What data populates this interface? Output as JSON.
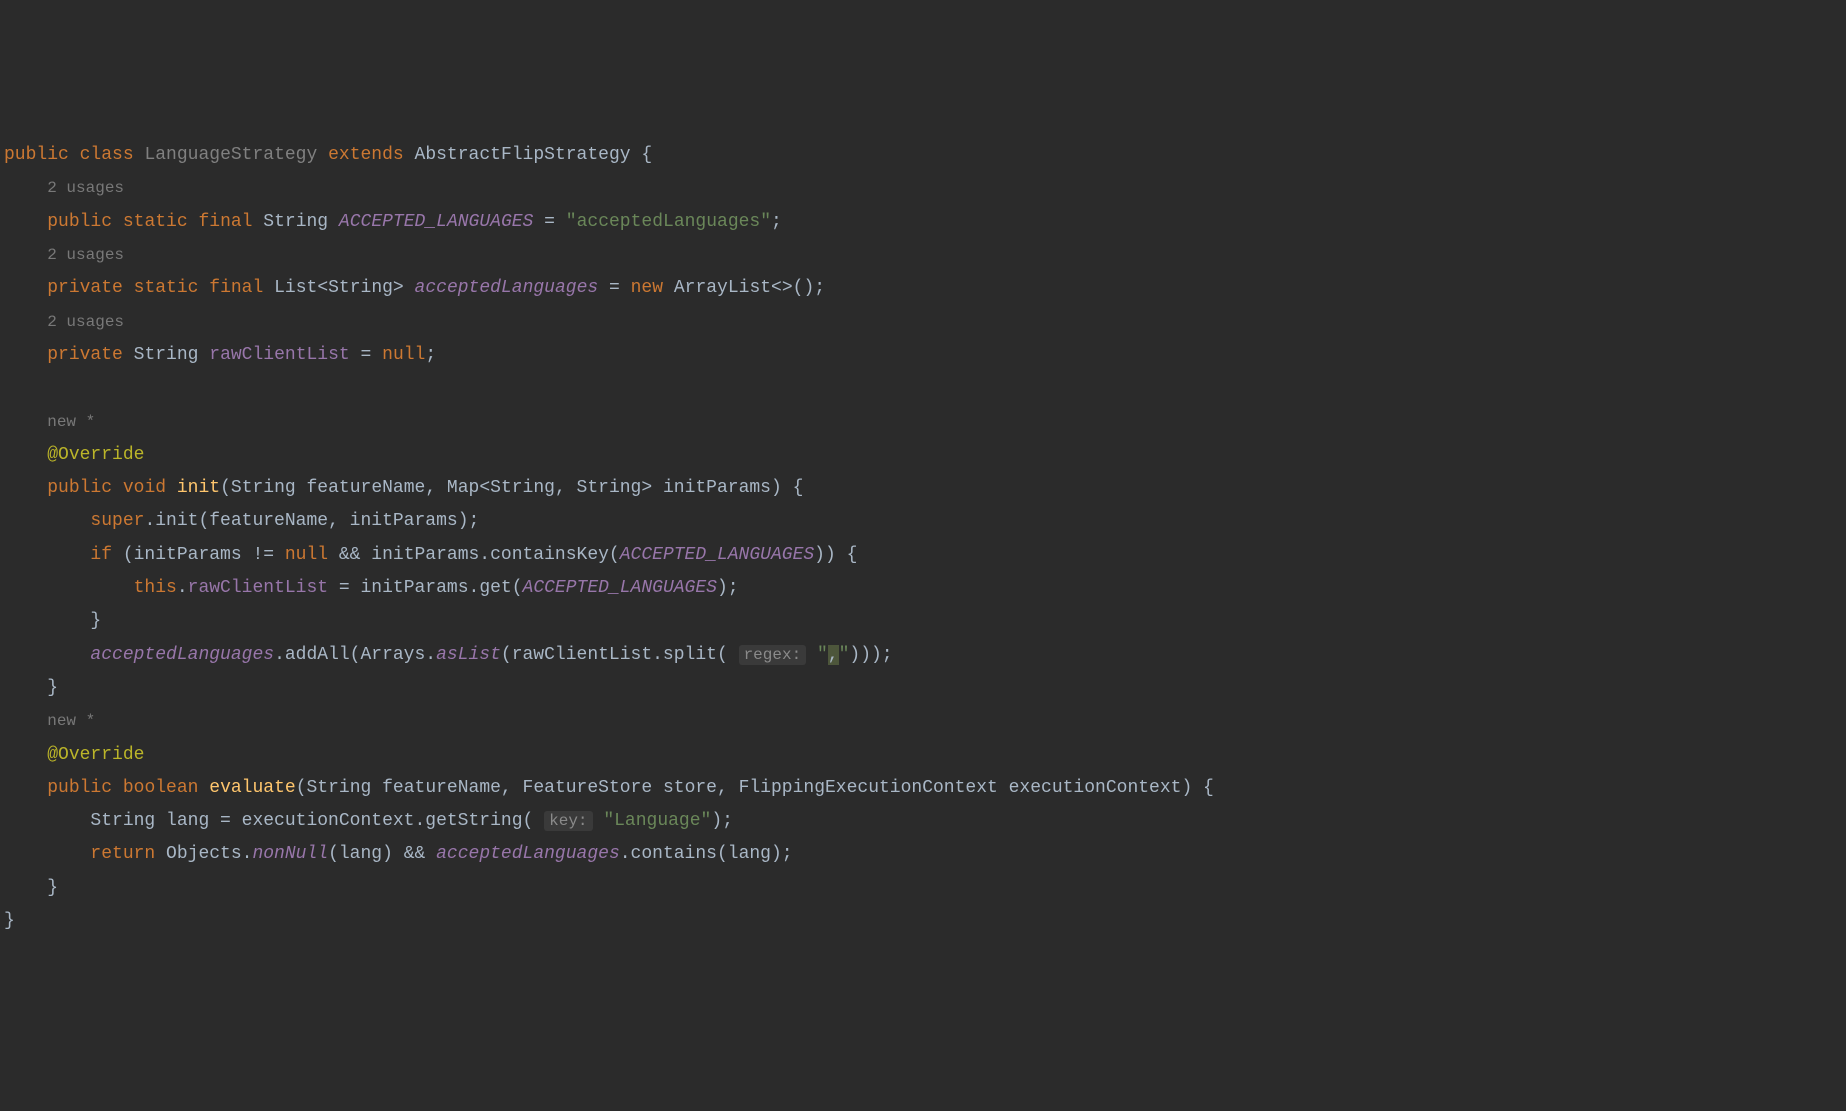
{
  "line1": {
    "kw_public": "public",
    "kw_class": "class",
    "class_name": "LanguageStrategy",
    "kw_extends": "extends",
    "parent": "AbstractFlipStrategy",
    "brace": "{"
  },
  "hint1": "2 usages",
  "line2": {
    "kw_public": "public",
    "kw_static": "static",
    "kw_final": "final",
    "type": "String",
    "name": "ACCEPTED_LANGUAGES",
    "eq": "=",
    "value": "\"acceptedLanguages\"",
    "semi": ";"
  },
  "hint2": "2 usages",
  "line3": {
    "kw_private": "private",
    "kw_static": "static",
    "kw_final": "final",
    "type": "List<String>",
    "name": "acceptedLanguages",
    "eq": "=",
    "kw_new": "new",
    "ctor": "ArrayList<>()",
    "semi": ";"
  },
  "hint3": "2 usages",
  "line4": {
    "kw_private": "private",
    "type": "String",
    "name": "rawClientList",
    "eq": "=",
    "null": "null",
    "semi": ";"
  },
  "hint_new1": "new *",
  "anno1": "@Override",
  "method1": {
    "kw_public": "public",
    "kw_void": "void",
    "name": "init",
    "params": "(String featureName, Map<String, String> initParams) {"
  },
  "m1_l1": {
    "super": "super",
    "rest": ".init(featureName, initParams);"
  },
  "m1_l2": {
    "kw_if": "if",
    "open": " (initParams != ",
    "null": "null",
    "and": " && initParams.containsKey(",
    "const": "ACCEPTED_LANGUAGES",
    "close": ")) {"
  },
  "m1_l3": {
    "this": "this",
    "dot": ".",
    "field": "rawClientList",
    "eq": " = initParams.get(",
    "const": "ACCEPTED_LANGUAGES",
    "close": ");"
  },
  "m1_l4": "}",
  "m1_l5": {
    "field": "acceptedLanguages",
    "add": ".addAll(Arrays.",
    "aslist": "asList",
    "open": "(rawClientList.split(",
    "hint_label": "regex:",
    "str_open": " \"",
    "comma": ",",
    "str_close": "\"",
    "close": ")));"
  },
  "m1_close": "}",
  "hint_new2": "new *",
  "anno2": "@Override",
  "method2": {
    "kw_public": "public",
    "kw_boolean": "boolean",
    "name": "evaluate",
    "params": "(String featureName, FeatureStore store, FlippingExecutionContext executionContext) {"
  },
  "m2_l1": {
    "type": "String lang = executionContext.getString(",
    "hint_label": "key:",
    "str": " \"Language\"",
    "close": ");"
  },
  "m2_l2": {
    "kw_return": "return",
    "objects": " Objects.",
    "nonnull": "nonNull",
    "mid": "(lang) && ",
    "field": "acceptedLanguages",
    "close": ".contains(lang);"
  },
  "m2_close": "}",
  "class_close": "}"
}
